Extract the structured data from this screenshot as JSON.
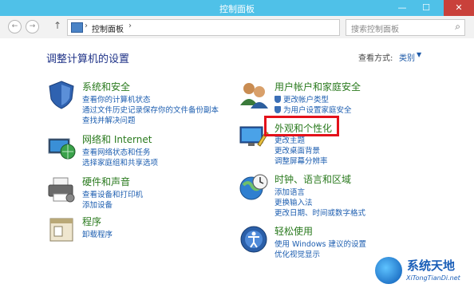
{
  "window": {
    "title": "控制面板"
  },
  "navbar": {
    "back_glyph": "←",
    "forward_glyph": "→",
    "up_glyph": "↑",
    "addr_sep1": "›",
    "address": "控制面板",
    "addr_sep2": "›",
    "dropdown_glyph": "⌄",
    "refresh_glyph": "↻",
    "search_placeholder": "搜索控制面板",
    "search_glyph": "⌕"
  },
  "main": {
    "heading": "调整计算机的设置",
    "view_by_label": "查看方式:",
    "view_by_value": "类别"
  },
  "left": [
    {
      "icon": "shield-icon",
      "title": "系统和安全",
      "links": [
        "查看你的计算机状态",
        "通过文件历史记录保存你的文件备份副本",
        "查找并解决问题"
      ]
    },
    {
      "icon": "network-icon",
      "title": "网络和 Internet",
      "links": [
        "查看网络状态和任务",
        "选择家庭组和共享选项"
      ]
    },
    {
      "icon": "printer-icon",
      "title": "硬件和声音",
      "links": [
        "查看设备和打印机",
        "添加设备"
      ]
    },
    {
      "icon": "programs-icon",
      "title": "程序",
      "links": [
        "卸载程序"
      ]
    }
  ],
  "right": [
    {
      "icon": "users-icon",
      "title": "用户帐户和家庭安全",
      "links": [
        "更改帐户类型",
        "为用户设置家庭安全"
      ]
    },
    {
      "icon": "appearance-icon",
      "title": "外观和个性化",
      "links": [
        "更改主题",
        "更改桌面背景",
        "调整屏幕分辨率"
      ]
    },
    {
      "icon": "globe-clock-icon",
      "title": "时钟、语言和区域",
      "links": [
        "添加语言",
        "更换输入法",
        "更改日期、时间或数字格式"
      ]
    },
    {
      "icon": "ease-of-access-icon",
      "title": "轻松使用",
      "links": [
        "使用 Windows 建议的设置",
        "优化视觉显示"
      ]
    }
  ],
  "watermark": {
    "title": "系统天地",
    "subtitle": "XiTongTianDi.net"
  },
  "colors": {
    "titlebar": "#4fc1e8",
    "link": "#1d5eb0",
    "category_title": "#2a7a1e",
    "highlight": "#e3121b"
  }
}
